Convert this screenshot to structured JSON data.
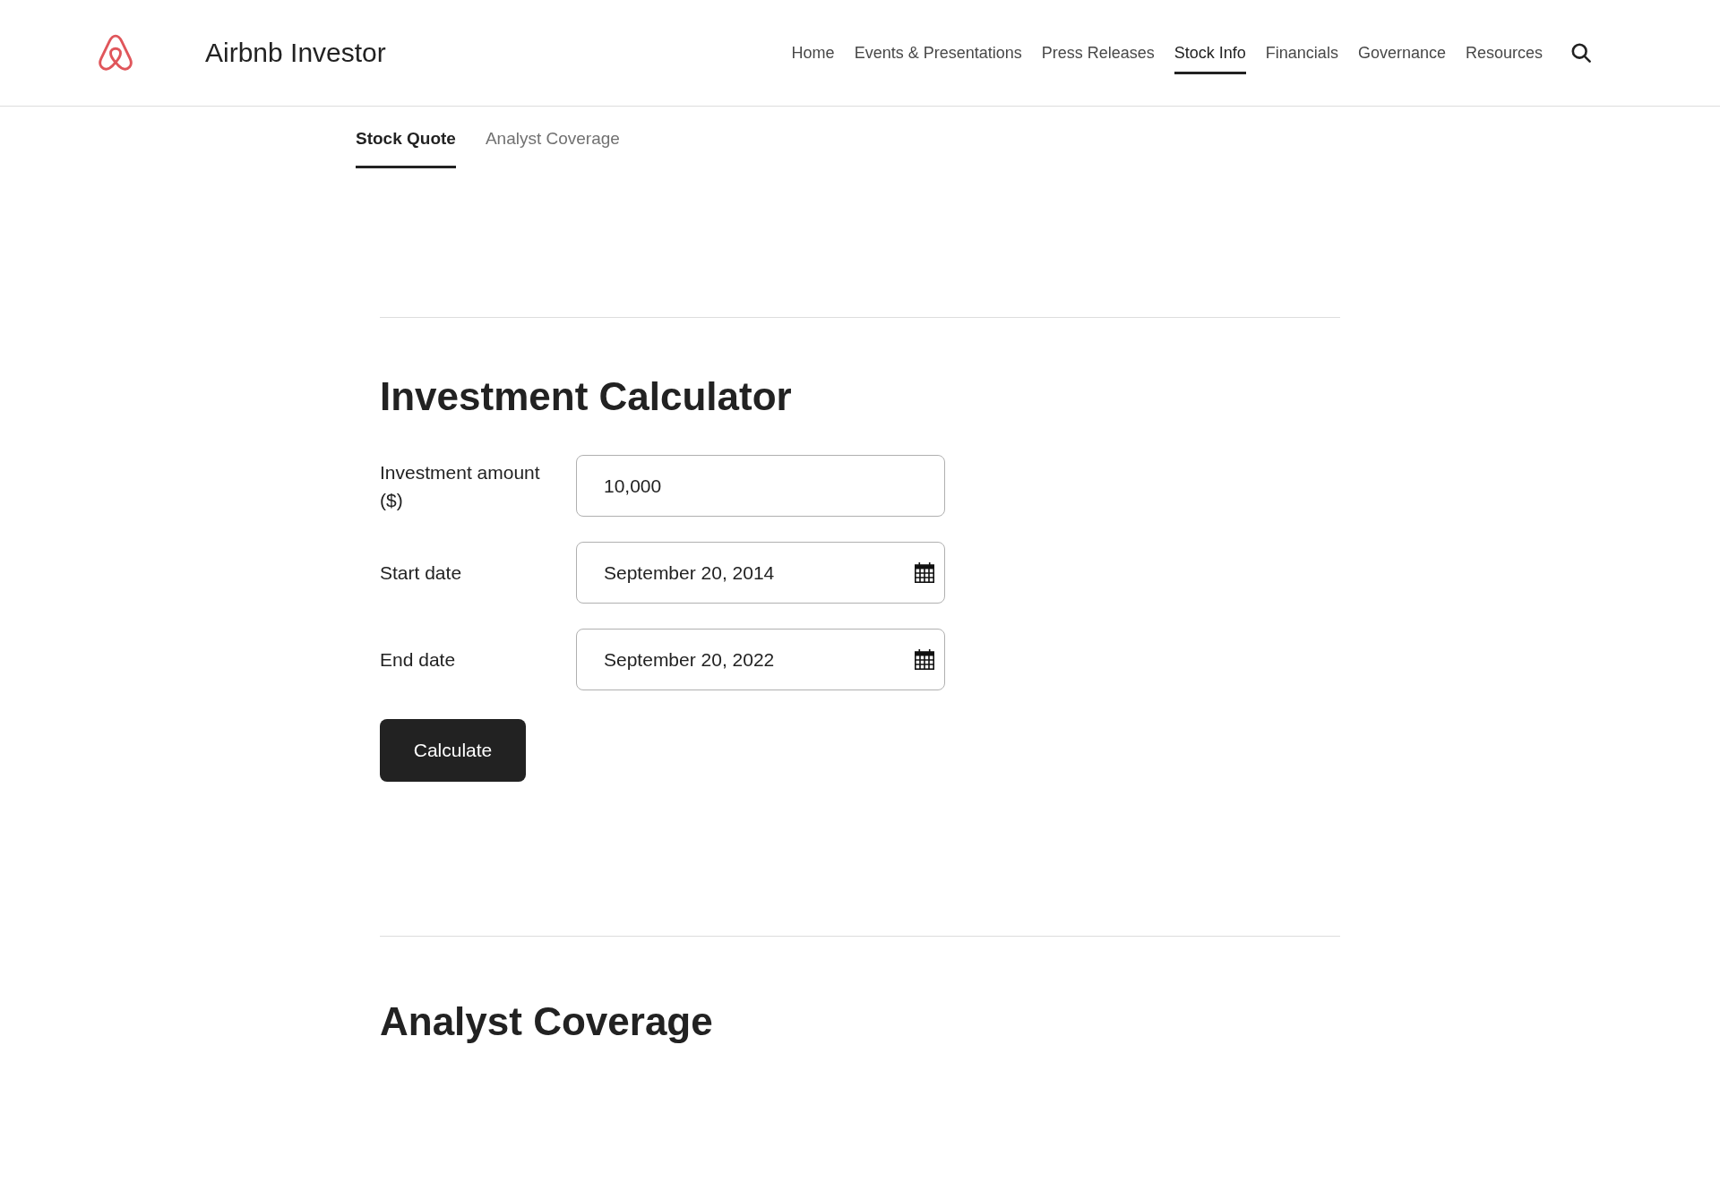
{
  "header": {
    "title": "Airbnb Investor",
    "nav": [
      {
        "label": "Home",
        "selected": false
      },
      {
        "label": "Events & Presentations",
        "selected": false
      },
      {
        "label": "Press Releases",
        "selected": false
      },
      {
        "label": "Stock Info",
        "selected": true
      },
      {
        "label": "Financials",
        "selected": false
      },
      {
        "label": "Governance",
        "selected": false
      },
      {
        "label": "Resources",
        "selected": false
      }
    ]
  },
  "subnav": [
    {
      "label": "Stock Quote",
      "selected": true
    },
    {
      "label": "Analyst Coverage",
      "selected": false
    }
  ],
  "calculator": {
    "title": "Investment Calculator",
    "fields": [
      {
        "kind": "text",
        "label": "Investment amount ($)",
        "value": "10,000"
      },
      {
        "kind": "date",
        "label": "Start date",
        "value": "September 20, 2014"
      },
      {
        "kind": "date",
        "label": "End date",
        "value": "September 20, 2022"
      }
    ],
    "button": "Calculate"
  },
  "analyst_coverage": {
    "title": "Analyst Coverage"
  }
}
